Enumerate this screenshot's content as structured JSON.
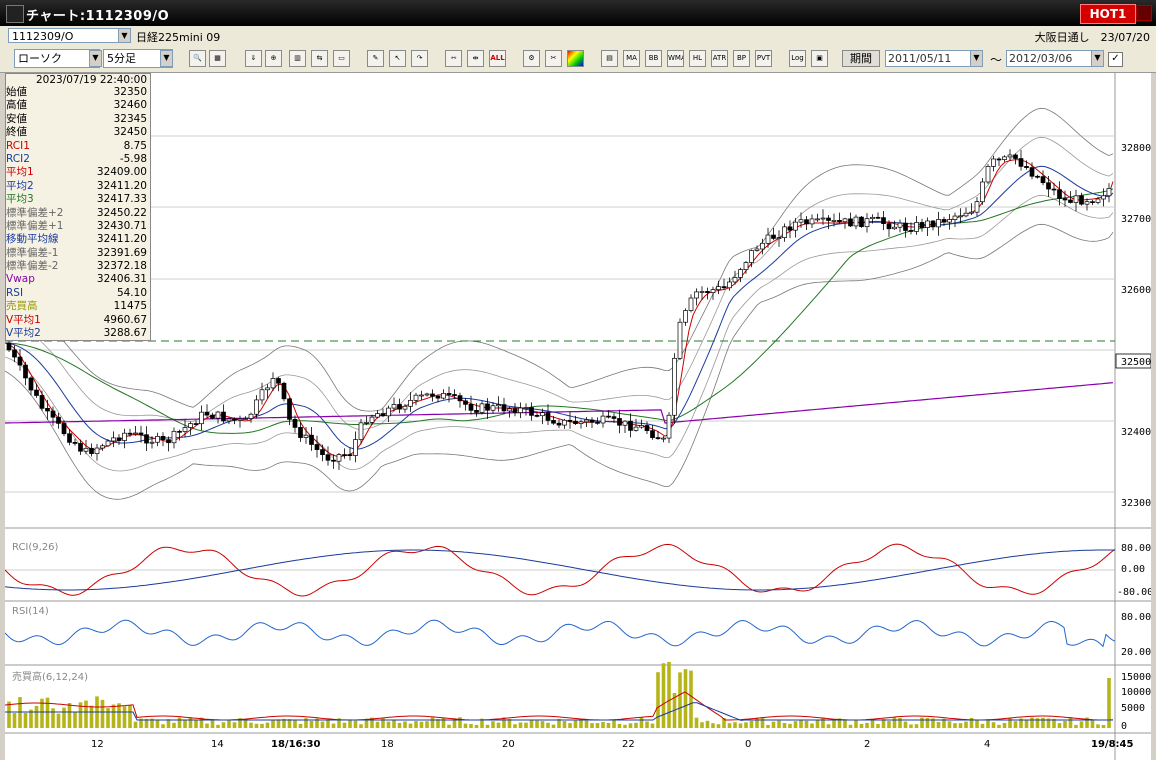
{
  "window": {
    "title": "チャート:1112309/O",
    "hot_label": "HOT1"
  },
  "header": {
    "symbol": "1112309/O",
    "instrument": "日経225mini 09",
    "session": "大阪日通し　23/07/20"
  },
  "toolbar": {
    "chart_type": "ローソク",
    "timeframe": "5分足",
    "kikan_label": "期間",
    "date_from": "2011/05/11",
    "date_to": "2012/03/06",
    "tilde": "～",
    "buttons": [
      "ALL",
      "MA",
      "BB",
      "WMA",
      "HL",
      "ATR",
      "BP",
      "PVT",
      "Log"
    ]
  },
  "infobox": {
    "timestamp": "2023/07/19  22:40:00",
    "rows": [
      {
        "label": "始値",
        "value": "32350",
        "color": "#000000"
      },
      {
        "label": "高値",
        "value": "32460",
        "color": "#000000"
      },
      {
        "label": "安値",
        "value": "32345",
        "color": "#000000"
      },
      {
        "label": "終値",
        "value": "32450",
        "color": "#000000"
      },
      {
        "label": "RCI1",
        "value": "8.75",
        "color": "#cc0000"
      },
      {
        "label": "RCI2",
        "value": "-5.98",
        "color": "#1a3a9a"
      },
      {
        "label": "平均1",
        "value": "32409.00",
        "color": "#cc0000"
      },
      {
        "label": "平均2",
        "value": "32411.20",
        "color": "#1a3a9a"
      },
      {
        "label": "平均3",
        "value": "32417.33",
        "color": "#227722"
      },
      {
        "label": "標準偏差+2",
        "value": "32450.22",
        "color": "#666666"
      },
      {
        "label": "標準偏差+1",
        "value": "32430.71",
        "color": "#666666"
      },
      {
        "label": "移動平均線",
        "value": "32411.20",
        "color": "#1a3a9a"
      },
      {
        "label": "標準偏差-1",
        "value": "32391.69",
        "color": "#666666"
      },
      {
        "label": "標準偏差-2",
        "value": "32372.18",
        "color": "#666666"
      },
      {
        "label": "Vwap",
        "value": "32406.31",
        "color": "#8800aa"
      },
      {
        "label": "RSI",
        "value": "54.10",
        "color": "#1a3a9a"
      },
      {
        "label": "売買高",
        "value": "11475",
        "color": "#999900"
      },
      {
        "label": "V平均1",
        "value": "4960.67",
        "color": "#cc0000"
      },
      {
        "label": "V平均2",
        "value": "3288.67",
        "color": "#1a3a9a"
      }
    ]
  },
  "panels": {
    "price_axis": [
      "32800",
      "32700",
      "32600",
      "32500",
      "32400",
      "32300"
    ],
    "highlight_price": "32500",
    "rci_label": "RCI(9,26)",
    "rci_axis": [
      "80.00",
      "0.00",
      "-80.00"
    ],
    "rsi_label": "RSI(14)",
    "rsi_axis": [
      "80.00",
      "20.00"
    ],
    "vol_label": "売買高(6,12,24)",
    "vol_axis": [
      "15000",
      "10000",
      "5000",
      "0"
    ]
  },
  "x_axis": {
    "labels": [
      "12",
      "14",
      "18/16:30",
      "18",
      "20",
      "22",
      "0",
      "2",
      "4",
      "19/8:45"
    ]
  },
  "colors": {
    "up": "#ffffff",
    "down": "#000000",
    "ma1": "#cc0000",
    "ma2": "#1a3a9a",
    "ma3": "#227722",
    "vwap": "#8800aa",
    "bb": "#666666",
    "volume": "#b5b51a"
  }
}
